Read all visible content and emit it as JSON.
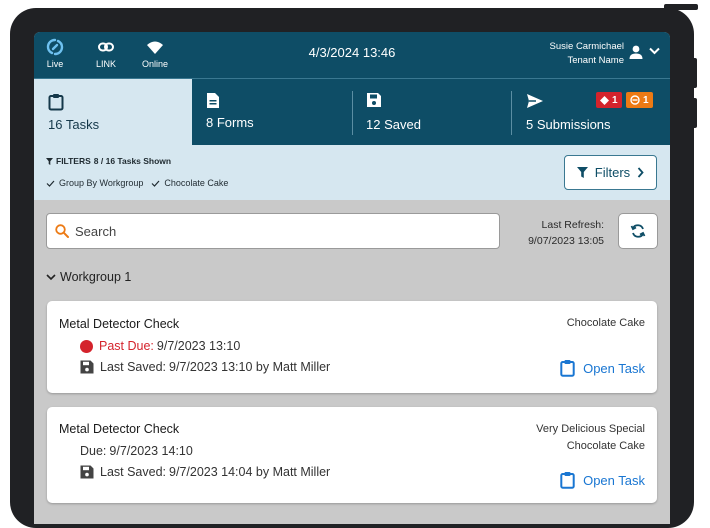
{
  "status_bar": {
    "live_label": "Live",
    "link_label": "LINK",
    "online_label": "Online",
    "datetime": "4/3/2024 13:46",
    "user_name": "Susie Carmichael",
    "tenant_name": "Tenant Name"
  },
  "tabs": [
    {
      "label": "16 Tasks",
      "icon": "clipboard-icon"
    },
    {
      "label": "8 Forms",
      "icon": "document-icon"
    },
    {
      "label": "12 Saved",
      "icon": "save-icon"
    },
    {
      "label": "5 Submissions",
      "icon": "send-icon"
    }
  ],
  "badges": {
    "red_count": "1",
    "orange_count": "1"
  },
  "filter_bar": {
    "title": "FILTERS",
    "count_text": "8 / 16 Tasks Shown",
    "checks": [
      "Group By Workgroup",
      "Chocolate Cake"
    ],
    "button_label": "Filters"
  },
  "search": {
    "placeholder": "Search"
  },
  "refresh": {
    "label": "Last Refresh:",
    "value": "9/07/2023  13:05"
  },
  "workgroup": {
    "label": "Workgroup 1"
  },
  "cards": [
    {
      "title": "Metal Detector Check",
      "due_label": "Past Due:",
      "due_value": "9/7/2023  13:10",
      "saved_label": "Last Saved:",
      "saved_value": "9/7/2023  13:10  by Matt Miller",
      "product": "Chocolate Cake",
      "action": "Open Task"
    },
    {
      "title": "Metal Detector Check",
      "due_label": "Due:",
      "due_value": "9/7/2023  14:10",
      "saved_label": "Last Saved:",
      "saved_value": "9/7/2023  14:04  by Matt Miller",
      "product": "Very Delicious Special Chocolate Cake",
      "action": "Open Task"
    }
  ],
  "colors": {
    "header": "#0e4d66",
    "active_tab": "#d6e7f0",
    "past_due": "#d4232c",
    "warning": "#ec7a14",
    "link": "#1976d2"
  }
}
